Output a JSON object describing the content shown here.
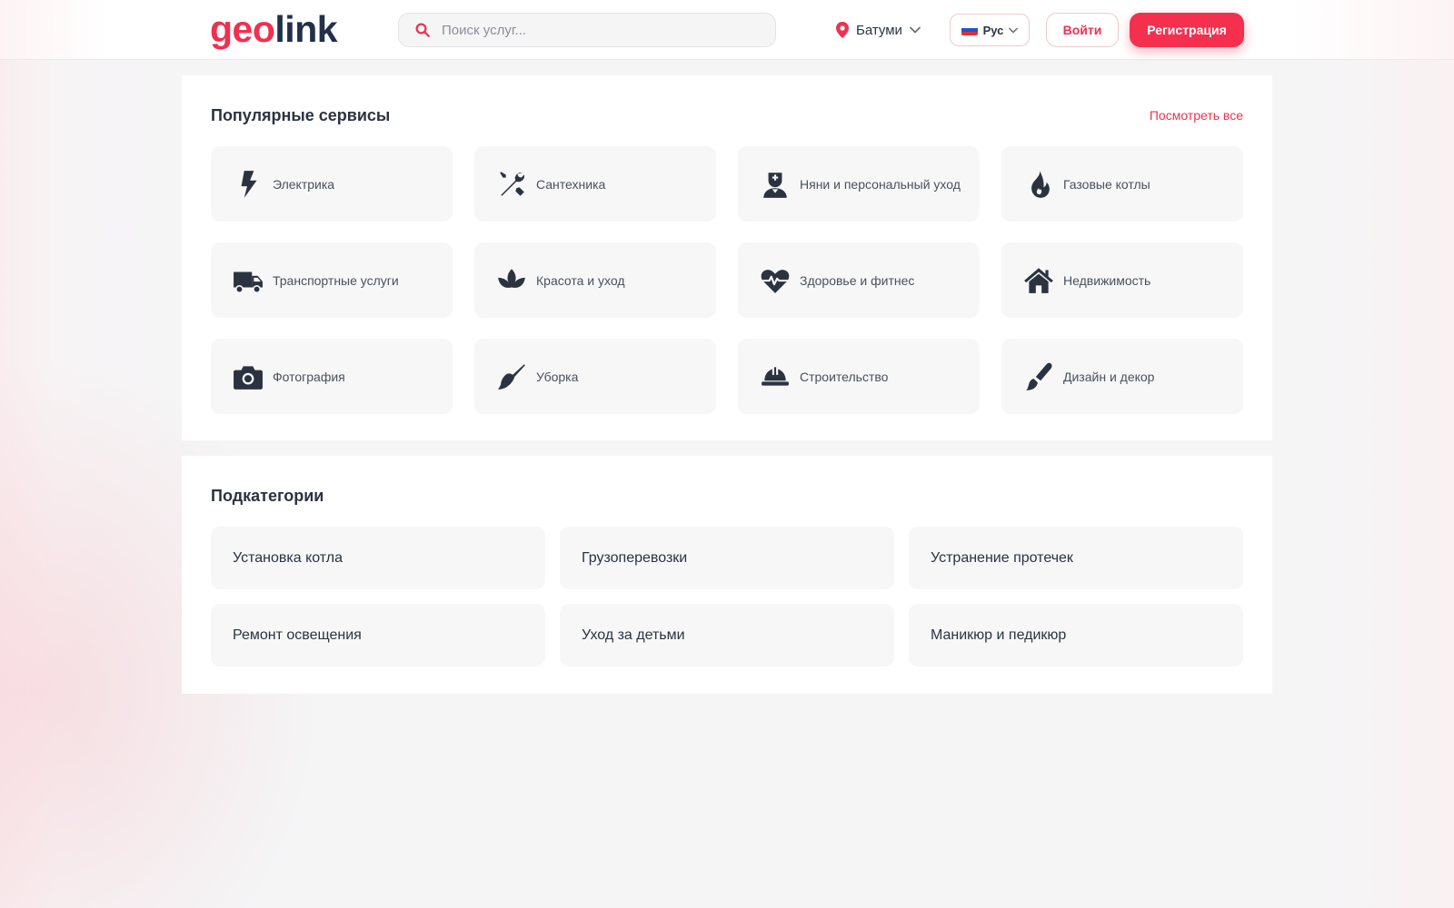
{
  "header": {
    "logo": {
      "part1": "geo",
      "part2": "link"
    },
    "search": {
      "placeholder": "Поиск услуг...",
      "value": ""
    },
    "city": "Батуми",
    "language": "Рус",
    "login_label": "Войти",
    "register_label": "Регистрация"
  },
  "popular": {
    "title": "Популярные сервисы",
    "see_all": "Посмотреть все",
    "items": [
      {
        "label": "Электрика",
        "icon": "bolt-icon"
      },
      {
        "label": "Сантехника",
        "icon": "tools-icon"
      },
      {
        "label": "Няни и персональный уход",
        "icon": "nurse-icon"
      },
      {
        "label": "Газовые котлы",
        "icon": "fire-icon"
      },
      {
        "label": "Транспортные услуги",
        "icon": "truck-icon"
      },
      {
        "label": "Красота и уход",
        "icon": "spa-icon"
      },
      {
        "label": "Здоровье и фитнес",
        "icon": "heartbeat-icon"
      },
      {
        "label": "Недвижимость",
        "icon": "home-icon"
      },
      {
        "label": "Фотография",
        "icon": "camera-icon"
      },
      {
        "label": "Уборка",
        "icon": "broom-icon"
      },
      {
        "label": "Строительство",
        "icon": "hardhat-icon"
      },
      {
        "label": "Дизайн и декор",
        "icon": "paintbrush-icon"
      }
    ]
  },
  "subcategories": {
    "title": "Подкатегории",
    "items": [
      "Установка котла",
      "Грузоперевозки",
      "Устранение протечек",
      "Ремонт освещения",
      "Уход за детьми",
      "Маникюр и педикюр"
    ]
  },
  "colors": {
    "accent": "#f0304f",
    "icon": "#2b3340",
    "card_bg": "#f7f7f8"
  }
}
